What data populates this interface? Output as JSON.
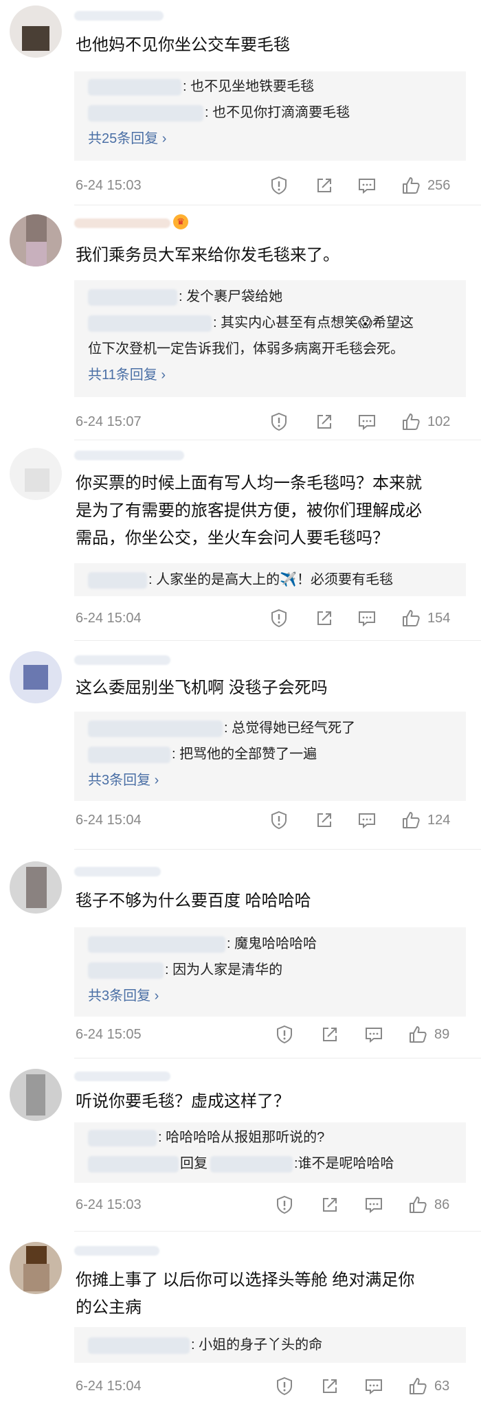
{
  "comments": [
    {
      "text": "也他妈不见你坐公交车要毛毯",
      "replies": [
        {
          "text": ": 也不见坐地铁要毛毯"
        },
        {
          "text": ": 也不见你打滴滴要毛毯"
        }
      ],
      "more": "共25条回复 ›",
      "time": "6-24 15:03",
      "likes": "256"
    },
    {
      "text": "我们乘务员大军来给你发毛毯来了。",
      "replies": [
        {
          "text": ": 发个裹尸袋给她"
        },
        {
          "text": ": 其实内心甚至有点想笑😱希望这"
        },
        {
          "text": "位下次登机一定告诉我们，体弱多病离开毛毯会死。"
        }
      ],
      "more": "共11条回复 ›",
      "time": "6-24 15:07",
      "likes": "102"
    },
    {
      "text_lines": [
        "你买票的时候上面有写人均一条毛毯吗？本来就",
        "是为了有需要的旅客提供方便，被你们理解成必",
        "需品，你坐公交，坐火车会问人要毛毯吗？"
      ],
      "replies": [
        {
          "text": ": 人家坐的是高大上的✈️！必须要有毛毯"
        }
      ],
      "time": "6-24 15:04",
      "likes": "154"
    },
    {
      "text": "这么委屈别坐飞机啊 没毯子会死吗",
      "replies": [
        {
          "text": ": 总觉得她已经气死了"
        },
        {
          "text": ": 把骂他的全部赞了一遍"
        }
      ],
      "more": "共3条回复 ›",
      "time": "6-24 15:04",
      "likes": "124"
    },
    {
      "text": "毯子不够为什么要百度 哈哈哈哈",
      "replies": [
        {
          "text": ": 魔鬼哈哈哈哈"
        },
        {
          "text": ": 因为人家是清华的"
        }
      ],
      "more": "共3条回复 ›",
      "time": "6-24 15:05",
      "likes": "89"
    },
    {
      "text": "听说你要毛毯？虚成这样了？",
      "replies": [
        {
          "text": ": 哈哈哈哈从报姐那听说的?"
        },
        {
          "text": "回复",
          "text2": ":谁不是呢哈哈哈"
        }
      ],
      "time": "6-24 15:03",
      "likes": "86"
    },
    {
      "text_lines": [
        "你摊上事了 以后你可以选择头等舱 绝对满足你",
        "的公主病"
      ],
      "replies": [
        {
          "text": ": 小姐的身子丫头的命"
        }
      ],
      "time": "6-24 15:04",
      "likes": "63"
    }
  ],
  "icons": {
    "report": "report-icon",
    "share": "share-icon",
    "comment": "comment-icon",
    "like": "like-icon"
  },
  "colors": {
    "link": "#4a6fa5",
    "meta": "#888888",
    "reply_bg": "#f5f5f5"
  }
}
